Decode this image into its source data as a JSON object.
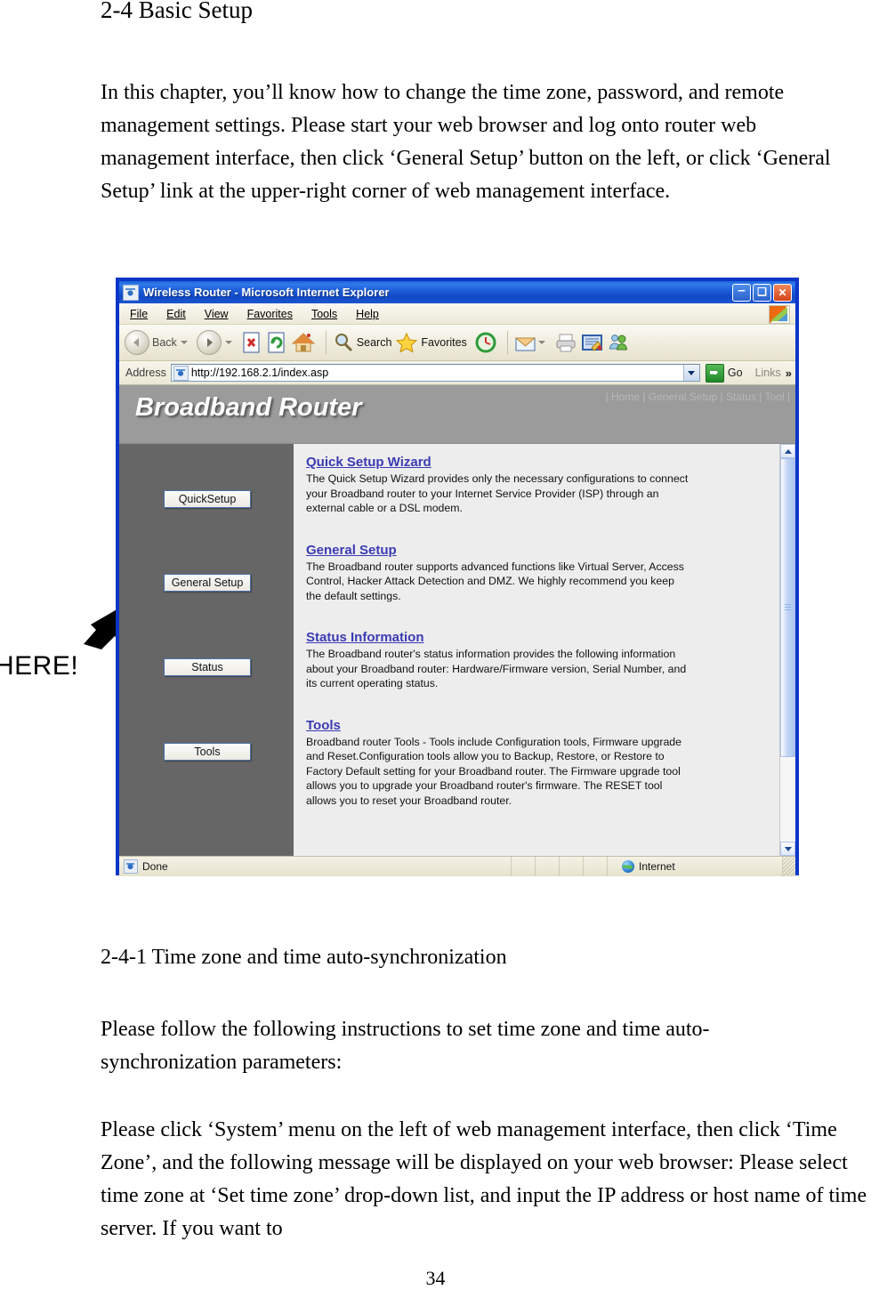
{
  "document": {
    "heading": "2-4 Basic Setup",
    "intro_paragraph": "In this chapter, you’ll know how to change the time zone, password, and remote management settings. Please start your web browser and log onto router web management interface, then click ‘General Setup’ button on the left, or click ‘General Setup’ link at the upper-right corner of web management interface.",
    "sub_heading": "2-4-1 Time zone and time auto-synchronization",
    "paragraph_follow": "Please follow the following instructions to set time zone and time auto-synchronization parameters:",
    "paragraph_click": "Please click ‘System’ menu on the left of web management interface, then click ‘Time Zone’, and the following message will be displayed on your web browser: Please select time zone at ‘Set time zone’ drop-down list, and input the IP address or host name of time server. If you want to",
    "page_number": "34"
  },
  "annotation": {
    "label": "HERE!",
    "arrow_icon": "arrow-pointing-up-right"
  },
  "browser": {
    "title": "Wireless Router - Microsoft Internet Explorer",
    "window_controls": {
      "minimize": "–",
      "maximize": "❑",
      "close": "✕"
    },
    "menu": [
      {
        "pre": "F",
        "accel": "",
        "label": "File",
        "a": 0
      },
      {
        "label": "Edit",
        "a": 0
      },
      {
        "label": "View",
        "a": 0
      },
      {
        "label": "Favorites",
        "a": 1
      },
      {
        "label": "Tools",
        "a": 0
      },
      {
        "label": "Help",
        "a": 1
      }
    ],
    "menu_labels": [
      "File",
      "Edit",
      "View",
      "Favorites",
      "Tools",
      "Help"
    ],
    "toolbar": {
      "back_label": "Back",
      "forward_label": "",
      "search_label": "Search",
      "favorites_label": "Favorites",
      "icons": [
        "back-icon",
        "forward-icon",
        "stop-icon",
        "refresh-icon",
        "home-icon",
        "search-icon",
        "favorites-star-icon",
        "history-icon",
        "mail-icon",
        "print-icon",
        "edit-icon",
        "messenger-icon"
      ]
    },
    "address": {
      "label": "Address",
      "url": "http://192.168.2.1/index.asp",
      "go_label": "Go",
      "links_label": "Links",
      "overflow_label": "»"
    },
    "statusbar": {
      "status_text": "Done",
      "zone_text": "Internet"
    }
  },
  "router_page": {
    "logo": "Broadband Router",
    "nav_links": "| Home | General Setup | Status | Tool |",
    "sidebar_buttons": [
      {
        "id": "quicksetup",
        "label": "QuickSetup"
      },
      {
        "id": "generalsetup",
        "label": "General Setup"
      },
      {
        "id": "status",
        "label": "Status"
      },
      {
        "id": "tools",
        "label": "Tools"
      }
    ],
    "sections": [
      {
        "title": "Quick Setup Wizard",
        "body": "The Quick Setup Wizard provides only the necessary configurations to connect your Broadband router to your Internet Service Provider (ISP) through an external cable or a DSL modem."
      },
      {
        "title": "General Setup",
        "body": "The Broadband router supports advanced functions like Virtual Server, Access Control, Hacker Attack Detection and DMZ. We highly recommend you keep the default settings."
      },
      {
        "title": "Status Information",
        "body": "The Broadband router's status information provides the following information about your Broadband router: Hardware/Firmware version, Serial Number, and its current operating status."
      },
      {
        "title": "Tools",
        "body": "Broadband router Tools - Tools include Configuration tools, Firmware upgrade and Reset.Configuration tools allow you to Backup, Restore, or Restore to Factory Default setting for your Broadband router. The Firmware upgrade tool allows you to upgrade your Broadband router's firmware. The RESET tool allows you to reset your Broadband router."
      }
    ]
  },
  "colors": {
    "title_bar": "#1e62d7",
    "banner_gray": "#9b9b9b",
    "sidebar_gray": "#666666",
    "link_blue": "#3b3bb3",
    "window_border": "#0a36c8"
  }
}
